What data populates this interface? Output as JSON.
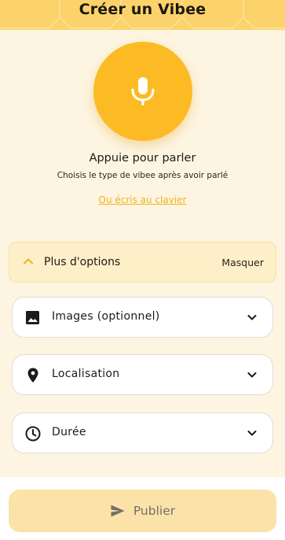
{
  "header": {
    "title": "Créer un Vibee"
  },
  "voice": {
    "mic_icon": "microphone-icon",
    "title": "Appuie pour parler",
    "subtitle": "Choisis le type de vibee après avoir parlé",
    "keyboard_link": "Ou écris au clavier"
  },
  "options": {
    "label": "Plus d'options",
    "toggle": "Masquer",
    "icon": "chevron-up-icon"
  },
  "fields": [
    {
      "label": "Images (optionnel)",
      "icon": "image-icon"
    },
    {
      "label": "Localisation",
      "icon": "location-pin-icon"
    },
    {
      "label": "Durée",
      "icon": "clock-icon"
    }
  ],
  "footer": {
    "publish_label": "Publier",
    "icon": "send-icon"
  },
  "colors": {
    "background": "#fdf5e2",
    "header": "#fcd36a",
    "accent": "#fcba25",
    "link": "#f0b21c",
    "publish_disabled": "#fbe2a8"
  }
}
